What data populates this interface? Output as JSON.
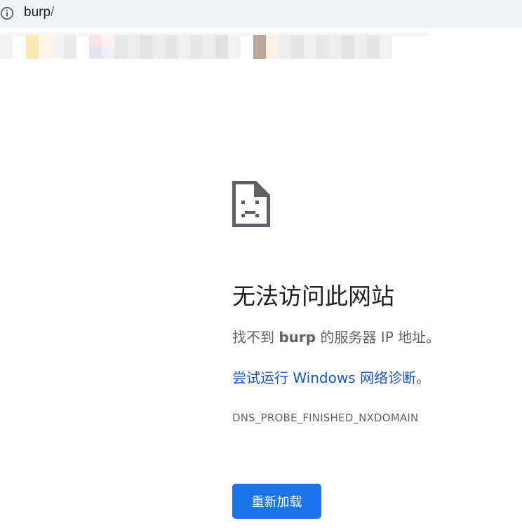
{
  "address_bar": {
    "icon": "info-icon",
    "host": "burp",
    "path": "/"
  },
  "bookmarks": {
    "note_visible": false
  },
  "error": {
    "icon": "sad-page-icon",
    "title": "无法访问此网站",
    "subtitle_prefix": "找不到 ",
    "subtitle_host": "burp",
    "subtitle_suffix": " 的服务器 IP 地址。",
    "suggestion_link": "尝试运行 Windows 网络诊断",
    "suggestion_end": "。",
    "code": "DNS_PROBE_FINISHED_NXDOMAIN",
    "reload_label": "重新加载"
  },
  "colors": {
    "address_bar_bg": "#f1f3f4",
    "link": "#1a57c6",
    "button": "#1a73e8",
    "text_primary": "#202124",
    "text_secondary": "#5f6368"
  }
}
